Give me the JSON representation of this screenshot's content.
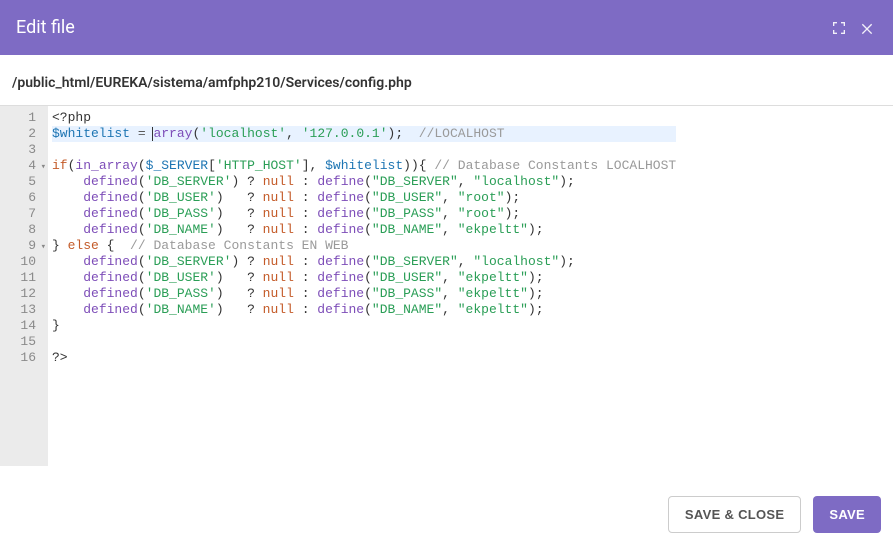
{
  "header": {
    "title": "Edit file"
  },
  "path": "/public_html/EUREKA/sistema/amfphp210/Services/config.php",
  "buttons": {
    "save_close": "SAVE & CLOSE",
    "save": "SAVE"
  },
  "colors": {
    "accent": "#7e6bc4"
  },
  "code": {
    "lines": [
      {
        "n": 1,
        "fold": false,
        "tokens": [
          [
            "tok-default",
            "<?php"
          ]
        ]
      },
      {
        "n": 2,
        "fold": false,
        "selected": true,
        "tokens": [
          [
            "tok-var",
            "$whitelist"
          ],
          [
            "tok-default",
            " "
          ],
          [
            "tok-op",
            "="
          ],
          [
            "tok-default",
            " "
          ],
          [
            "tok-fn",
            "array"
          ],
          [
            "tok-punc",
            "("
          ],
          [
            "tok-str",
            "'localhost'"
          ],
          [
            "tok-punc",
            ", "
          ],
          [
            "tok-str",
            "'127.0.0.1'"
          ],
          [
            "tok-punc",
            ");  "
          ],
          [
            "tok-com",
            "//LOCALHOST"
          ]
        ]
      },
      {
        "n": 3,
        "fold": false,
        "tokens": []
      },
      {
        "n": 4,
        "fold": true,
        "tokens": [
          [
            "tok-kw",
            "if"
          ],
          [
            "tok-punc",
            "("
          ],
          [
            "tok-fn",
            "in_array"
          ],
          [
            "tok-punc",
            "("
          ],
          [
            "tok-var",
            "$_SERVER"
          ],
          [
            "tok-punc",
            "["
          ],
          [
            "tok-str",
            "'HTTP_HOST'"
          ],
          [
            "tok-punc",
            "], "
          ],
          [
            "tok-var",
            "$whitelist"
          ],
          [
            "tok-punc",
            ")){ "
          ],
          [
            "tok-com",
            "// Database Constants LOCALHOST"
          ]
        ]
      },
      {
        "n": 5,
        "fold": false,
        "tokens": [
          [
            "tok-default",
            "    "
          ],
          [
            "tok-fn",
            "defined"
          ],
          [
            "tok-punc",
            "("
          ],
          [
            "tok-str",
            "'DB_SERVER'"
          ],
          [
            "tok-punc",
            ") ? "
          ],
          [
            "tok-null",
            "null"
          ],
          [
            "tok-punc",
            " : "
          ],
          [
            "tok-fn",
            "define"
          ],
          [
            "tok-punc",
            "("
          ],
          [
            "tok-str",
            "\"DB_SERVER\""
          ],
          [
            "tok-punc",
            ", "
          ],
          [
            "tok-str",
            "\"localhost\""
          ],
          [
            "tok-punc",
            ");"
          ]
        ]
      },
      {
        "n": 6,
        "fold": false,
        "tokens": [
          [
            "tok-default",
            "    "
          ],
          [
            "tok-fn",
            "defined"
          ],
          [
            "tok-punc",
            "("
          ],
          [
            "tok-str",
            "'DB_USER'"
          ],
          [
            "tok-punc",
            ")   ? "
          ],
          [
            "tok-null",
            "null"
          ],
          [
            "tok-punc",
            " : "
          ],
          [
            "tok-fn",
            "define"
          ],
          [
            "tok-punc",
            "("
          ],
          [
            "tok-str",
            "\"DB_USER\""
          ],
          [
            "tok-punc",
            ", "
          ],
          [
            "tok-str",
            "\"root\""
          ],
          [
            "tok-punc",
            ");"
          ]
        ]
      },
      {
        "n": 7,
        "fold": false,
        "tokens": [
          [
            "tok-default",
            "    "
          ],
          [
            "tok-fn",
            "defined"
          ],
          [
            "tok-punc",
            "("
          ],
          [
            "tok-str",
            "'DB_PASS'"
          ],
          [
            "tok-punc",
            ")   ? "
          ],
          [
            "tok-null",
            "null"
          ],
          [
            "tok-punc",
            " : "
          ],
          [
            "tok-fn",
            "define"
          ],
          [
            "tok-punc",
            "("
          ],
          [
            "tok-str",
            "\"DB_PASS\""
          ],
          [
            "tok-punc",
            ", "
          ],
          [
            "tok-str",
            "\"root\""
          ],
          [
            "tok-punc",
            ");"
          ]
        ]
      },
      {
        "n": 8,
        "fold": false,
        "tokens": [
          [
            "tok-default",
            "    "
          ],
          [
            "tok-fn",
            "defined"
          ],
          [
            "tok-punc",
            "("
          ],
          [
            "tok-str",
            "'DB_NAME'"
          ],
          [
            "tok-punc",
            ")   ? "
          ],
          [
            "tok-null",
            "null"
          ],
          [
            "tok-punc",
            " : "
          ],
          [
            "tok-fn",
            "define"
          ],
          [
            "tok-punc",
            "("
          ],
          [
            "tok-str",
            "\"DB_NAME\""
          ],
          [
            "tok-punc",
            ", "
          ],
          [
            "tok-str",
            "\"ekpeltt\""
          ],
          [
            "tok-punc",
            ");"
          ]
        ]
      },
      {
        "n": 9,
        "fold": true,
        "tokens": [
          [
            "tok-punc",
            "} "
          ],
          [
            "tok-kw",
            "else"
          ],
          [
            "tok-punc",
            " {  "
          ],
          [
            "tok-com",
            "// Database Constants EN WEB"
          ]
        ]
      },
      {
        "n": 10,
        "fold": false,
        "tokens": [
          [
            "tok-default",
            "    "
          ],
          [
            "tok-fn",
            "defined"
          ],
          [
            "tok-punc",
            "("
          ],
          [
            "tok-str",
            "'DB_SERVER'"
          ],
          [
            "tok-punc",
            ") ? "
          ],
          [
            "tok-null",
            "null"
          ],
          [
            "tok-punc",
            " : "
          ],
          [
            "tok-fn",
            "define"
          ],
          [
            "tok-punc",
            "("
          ],
          [
            "tok-str",
            "\"DB_SERVER\""
          ],
          [
            "tok-punc",
            ", "
          ],
          [
            "tok-str",
            "\"localhost\""
          ],
          [
            "tok-punc",
            ");"
          ]
        ]
      },
      {
        "n": 11,
        "fold": false,
        "tokens": [
          [
            "tok-default",
            "    "
          ],
          [
            "tok-fn",
            "defined"
          ],
          [
            "tok-punc",
            "("
          ],
          [
            "tok-str",
            "'DB_USER'"
          ],
          [
            "tok-punc",
            ")   ? "
          ],
          [
            "tok-null",
            "null"
          ],
          [
            "tok-punc",
            " : "
          ],
          [
            "tok-fn",
            "define"
          ],
          [
            "tok-punc",
            "("
          ],
          [
            "tok-str",
            "\"DB_USER\""
          ],
          [
            "tok-punc",
            ", "
          ],
          [
            "tok-str",
            "\"ekpeltt\""
          ],
          [
            "tok-punc",
            ");"
          ]
        ]
      },
      {
        "n": 12,
        "fold": false,
        "tokens": [
          [
            "tok-default",
            "    "
          ],
          [
            "tok-fn",
            "defined"
          ],
          [
            "tok-punc",
            "("
          ],
          [
            "tok-str",
            "'DB_PASS'"
          ],
          [
            "tok-punc",
            ")   ? "
          ],
          [
            "tok-null",
            "null"
          ],
          [
            "tok-punc",
            " : "
          ],
          [
            "tok-fn",
            "define"
          ],
          [
            "tok-punc",
            "("
          ],
          [
            "tok-str",
            "\"DB_PASS\""
          ],
          [
            "tok-punc",
            ", "
          ],
          [
            "tok-str",
            "\"ekpeltt\""
          ],
          [
            "tok-punc",
            ");"
          ]
        ]
      },
      {
        "n": 13,
        "fold": false,
        "tokens": [
          [
            "tok-default",
            "    "
          ],
          [
            "tok-fn",
            "defined"
          ],
          [
            "tok-punc",
            "("
          ],
          [
            "tok-str",
            "'DB_NAME'"
          ],
          [
            "tok-punc",
            ")   ? "
          ],
          [
            "tok-null",
            "null"
          ],
          [
            "tok-punc",
            " : "
          ],
          [
            "tok-fn",
            "define"
          ],
          [
            "tok-punc",
            "("
          ],
          [
            "tok-str",
            "\"DB_NAME\""
          ],
          [
            "tok-punc",
            ", "
          ],
          [
            "tok-str",
            "\"ekpeltt\""
          ],
          [
            "tok-punc",
            ");"
          ]
        ]
      },
      {
        "n": 14,
        "fold": false,
        "tokens": [
          [
            "tok-punc",
            "}"
          ]
        ]
      },
      {
        "n": 15,
        "fold": false,
        "tokens": []
      },
      {
        "n": 16,
        "fold": false,
        "tokens": [
          [
            "tok-default",
            "?>"
          ]
        ]
      }
    ]
  }
}
